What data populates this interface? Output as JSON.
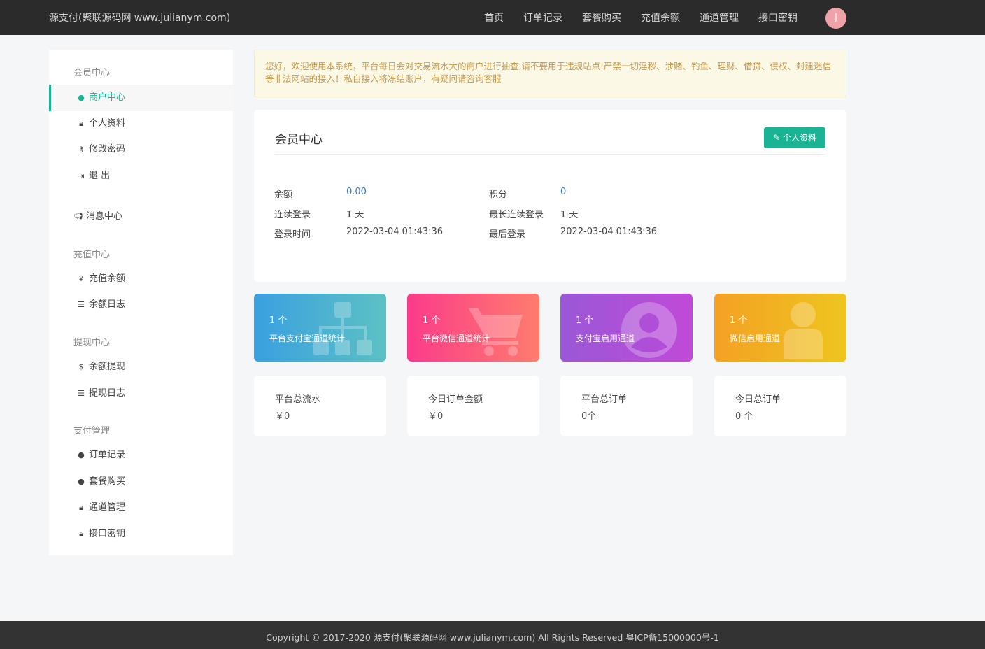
{
  "brand": "源支付(聚联源码网 www.julianym.com)",
  "nav": [
    "首页",
    "订单记录",
    "套餐购买",
    "充值余额",
    "通道管理",
    "接口密钥"
  ],
  "avatar_letter": "J",
  "sidebar": {
    "groups": {
      "member": "会员中心",
      "recharge": "充值中心",
      "withdraw": "提现中心",
      "payment": "支付管理"
    },
    "items": {
      "merchant": "商户中心",
      "profile": "个人资料",
      "password": "修改密码",
      "logout": "退 出",
      "messages": "消息中心",
      "recharge_balance": "充值余额",
      "balance_log": "余额日志",
      "withdraw_balance": "余额提现",
      "withdraw_log": "提现日志",
      "orders": "订单记录",
      "packages": "套餐购买",
      "channels": "通道管理",
      "api_key": "接口密钥"
    }
  },
  "notice": "您好，欢迎使用本系统，平台每日会对交易流水大的商户进行抽查,请不要用于违规站点!严禁一切淫秽、涉赌、钓鱼、理财、借贷、侵权、封建迷信等非法网站的接入！私自接入将冻结账户，有疑问请咨询客服",
  "panel": {
    "title": "会员中心",
    "profile_button": "个人资料",
    "balance_label": "余额",
    "balance_value": "0.00",
    "points_label": "积分",
    "points_value": "0",
    "streak_label": "连续登录",
    "streak_value": "1 天",
    "max_streak_label": "最长连续登录",
    "max_streak_value": "1 天",
    "login_time_label": "登录时间",
    "login_time_value": "2022-03-04 01:43:36",
    "last_login_label": "最后登录",
    "last_login_value": "2022-03-04 01:43:36"
  },
  "stat_cards": [
    {
      "count": "1 个",
      "label": "平台支付宝通道统计",
      "icon": "sitemap-icon",
      "color": "#3aa0e0"
    },
    {
      "count": "1 个",
      "label": "平台微信通道统计",
      "icon": "cart-icon",
      "color": "#fb3b8a"
    },
    {
      "count": "1 个",
      "label": "支付宝启用通道",
      "icon": "user-circle-icon",
      "color": "#9a58d6"
    },
    {
      "count": "1 个",
      "label": "微信启用通道",
      "icon": "user-icon",
      "color": "#f4a124"
    }
  ],
  "summary_cards": [
    {
      "title": "平台总流水",
      "value": "￥0"
    },
    {
      "title": "今日订单金额",
      "value": "￥0"
    },
    {
      "title": "平台总订单",
      "value": "0个"
    },
    {
      "title": "今日总订单",
      "value": "0 个"
    }
  ],
  "footer": "Copyright © 2017-2020 源支付(聚联源码网 www.julianym.com) All Rights Reserved 粤ICP备15000000号-1"
}
